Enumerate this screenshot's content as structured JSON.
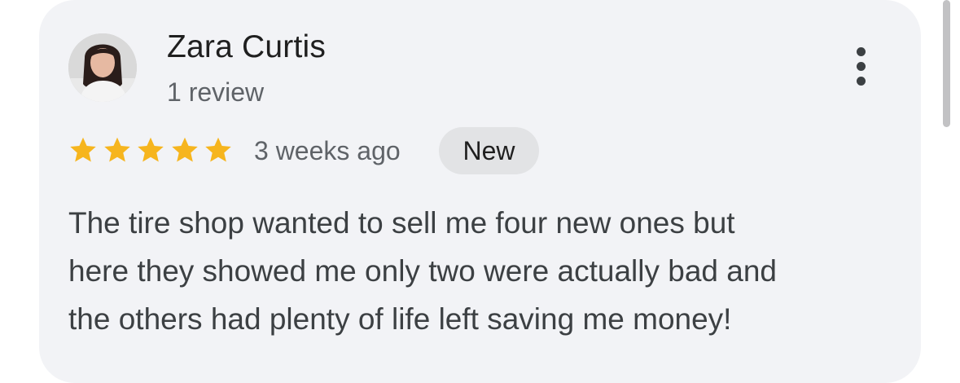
{
  "reviewer": {
    "name": "Zara Curtis",
    "review_count": "1 review"
  },
  "rating": {
    "stars": 5,
    "max_stars": 5,
    "star_color": "#f6b51e"
  },
  "timestamp": "3 weeks ago",
  "badge": "New",
  "review": {
    "lines": [
      "The tire shop wanted to sell me four new ones but",
      "here they showed me only two were actually bad and",
      "the others had plenty of life left saving me money!"
    ]
  },
  "icons": {
    "menu": "more-vertical-icon",
    "star": "star-icon",
    "avatar": "profile-photo"
  }
}
